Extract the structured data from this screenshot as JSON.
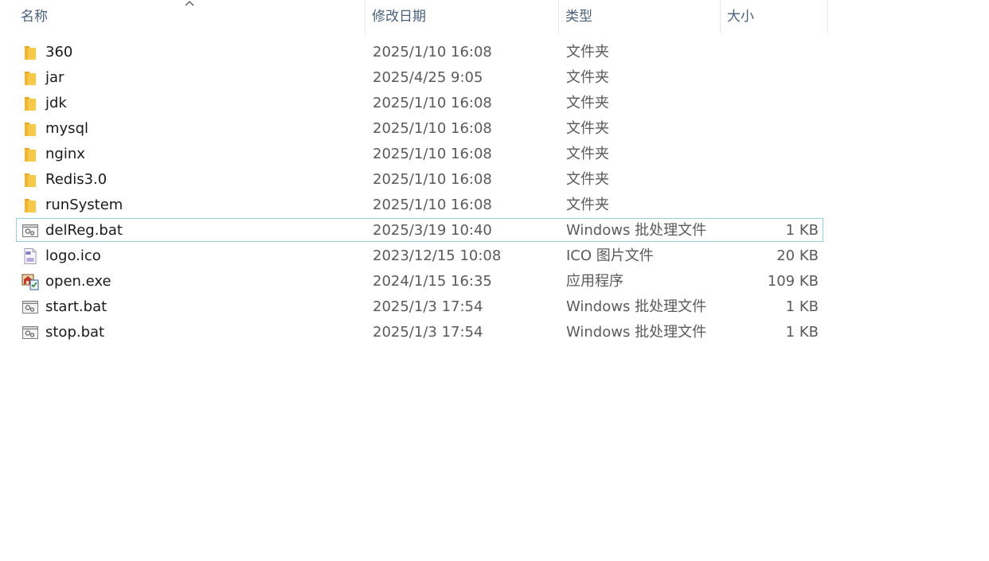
{
  "header": {
    "name": "名称",
    "date": "修改日期",
    "type": "类型",
    "size": "大小"
  },
  "files": [
    {
      "name": "360",
      "date": "2025/1/10 16:08",
      "type": "文件夹",
      "size": "",
      "icon": "folder-icon"
    },
    {
      "name": "jar",
      "date": "2025/4/25 9:05",
      "type": "文件夹",
      "size": "",
      "icon": "folder-icon"
    },
    {
      "name": "jdk",
      "date": "2025/1/10 16:08",
      "type": "文件夹",
      "size": "",
      "icon": "folder-icon"
    },
    {
      "name": "mysql",
      "date": "2025/1/10 16:08",
      "type": "文件夹",
      "size": "",
      "icon": "folder-icon"
    },
    {
      "name": "nginx",
      "date": "2025/1/10 16:08",
      "type": "文件夹",
      "size": "",
      "icon": "folder-icon"
    },
    {
      "name": "Redis3.0",
      "date": "2025/1/10 16:08",
      "type": "文件夹",
      "size": "",
      "icon": "folder-icon"
    },
    {
      "name": "runSystem",
      "date": "2025/1/10 16:08",
      "type": "文件夹",
      "size": "",
      "icon": "folder-icon"
    },
    {
      "name": "delReg.bat",
      "date": "2025/3/19 10:40",
      "type": "Windows 批处理文件",
      "size": "1 KB",
      "icon": "batch-file-icon",
      "selected": true
    },
    {
      "name": "logo.ico",
      "date": "2023/12/15 10:08",
      "type": "ICO 图片文件",
      "size": "20 KB",
      "icon": "image-file-icon"
    },
    {
      "name": "open.exe",
      "date": "2024/1/15 16:35",
      "type": "应用程序",
      "size": "109 KB",
      "icon": "application-icon"
    },
    {
      "name": "start.bat",
      "date": "2025/1/3 17:54",
      "type": "Windows 批处理文件",
      "size": "1 KB",
      "icon": "batch-file-icon"
    },
    {
      "name": "stop.bat",
      "date": "2025/1/3 17:54",
      "type": "Windows 批处理文件",
      "size": "1 KB",
      "icon": "batch-file-icon"
    }
  ],
  "colors": {
    "header_text": "#4c607a",
    "selection_border": "#99d1db",
    "folder": "#f7c948"
  }
}
